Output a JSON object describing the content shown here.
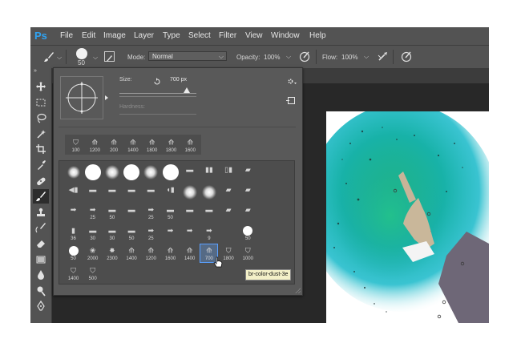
{
  "app": {
    "logo": "Ps",
    "menu": [
      "File",
      "Edit",
      "Image",
      "Layer",
      "Type",
      "Select",
      "Filter",
      "View",
      "Window",
      "Help"
    ]
  },
  "options_bar": {
    "brush_size": "50",
    "mode_label": "Mode:",
    "mode_value": "Normal",
    "opacity_label": "Opacity:",
    "opacity_value": "100%",
    "flow_label": "Flow:",
    "flow_value": "100%"
  },
  "toolbar": {
    "icons": [
      "move-icon",
      "marquee-icon",
      "lasso-icon",
      "quick-select-icon",
      "crop-icon",
      "eyedropper-icon",
      "healing-icon",
      "brush-icon",
      "stamp-icon",
      "history-brush-icon",
      "eraser-icon",
      "gradient-icon",
      "blur-icon",
      "dodge-icon",
      "pen-icon"
    ],
    "active_index": 7
  },
  "brush_panel": {
    "size_label": "Size:",
    "size_value": "700 px",
    "size_slider_fraction": 0.88,
    "hardness_label": "Hardness:",
    "top_row": [
      "100",
      "1200",
      "200",
      "1400",
      "1800",
      "1800",
      "1600"
    ],
    "grid": [
      [
        {
          "t": "soft",
          "s": 16,
          "n": ""
        },
        {
          "t": "hard",
          "s": 20,
          "n": ""
        },
        {
          "t": "soft",
          "s": 18,
          "n": ""
        },
        {
          "t": "hard",
          "s": 20,
          "n": ""
        },
        {
          "t": "soft",
          "s": 18,
          "n": ""
        },
        {
          "t": "hard",
          "s": 20,
          "n": ""
        },
        {
          "t": "glyph",
          "g": "▬",
          "n": ""
        },
        {
          "t": "glyph",
          "g": "▮▮",
          "n": ""
        },
        {
          "t": "glyph",
          "g": "▯▮",
          "n": ""
        },
        {
          "t": "glyph",
          "g": "▰",
          "n": ""
        }
      ],
      [
        {
          "t": "glyph",
          "g": "◀▮",
          "n": ""
        },
        {
          "t": "glyph",
          "g": "▬",
          "n": ""
        },
        {
          "t": "glyph",
          "g": "▬",
          "n": ""
        },
        {
          "t": "glyph",
          "g": "▬",
          "n": ""
        },
        {
          "t": "glyph",
          "g": "▬",
          "n": ""
        },
        {
          "t": "glyph",
          "g": "◖▮",
          "n": ""
        },
        {
          "t": "soft",
          "s": 18,
          "n": ""
        },
        {
          "t": "soft",
          "s": 18,
          "n": ""
        },
        {
          "t": "glyph",
          "g": "▰",
          "n": ""
        },
        {
          "t": "glyph",
          "g": "▰",
          "n": ""
        }
      ],
      [
        {
          "t": "glyph",
          "g": "➡",
          "n": ""
        },
        {
          "t": "glyph",
          "g": "➡",
          "n": "25"
        },
        {
          "t": "glyph",
          "g": "▬",
          "n": "50"
        },
        {
          "t": "glyph",
          "g": "▬",
          "n": ""
        },
        {
          "t": "glyph",
          "g": "➡",
          "n": "25"
        },
        {
          "t": "glyph",
          "g": "▬",
          "n": "50"
        },
        {
          "t": "glyph",
          "g": "▬",
          "n": ""
        },
        {
          "t": "glyph",
          "g": "▬",
          "n": ""
        },
        {
          "t": "glyph",
          "g": "▰",
          "n": ""
        },
        {
          "t": "glyph",
          "g": "▰",
          "n": ""
        }
      ],
      [
        {
          "t": "glyph",
          "g": "▮",
          "n": "36"
        },
        {
          "t": "glyph",
          "g": "▬",
          "n": "30"
        },
        {
          "t": "glyph",
          "g": "▬",
          "n": "30"
        },
        {
          "t": "glyph",
          "g": "▬",
          "n": "50"
        },
        {
          "t": "glyph",
          "g": "➡",
          "n": "25"
        },
        {
          "t": "glyph",
          "g": "➡",
          "n": ""
        },
        {
          "t": "glyph",
          "g": "➡",
          "n": ""
        },
        {
          "t": "glyph",
          "g": "➡",
          "n": "9"
        },
        {
          "t": "glyph",
          "g": "",
          "n": ""
        },
        {
          "t": "hard",
          "s": 12,
          "n": "50"
        }
      ],
      [
        {
          "t": "hard",
          "s": 12,
          "n": "50"
        },
        {
          "t": "glyph",
          "g": "❀",
          "n": "2000"
        },
        {
          "t": "glyph",
          "g": "✸",
          "n": "2300"
        },
        {
          "t": "glyph",
          "g": "⟰",
          "n": "1400"
        },
        {
          "t": "glyph",
          "g": "⟰",
          "n": "1200"
        },
        {
          "t": "glyph",
          "g": "⟰",
          "n": "1600"
        },
        {
          "t": "glyph",
          "g": "⟰",
          "n": "1400"
        },
        {
          "t": "glyph",
          "g": "⟰",
          "n": "700",
          "sel": true
        },
        {
          "t": "glyph",
          "g": "⛉",
          "n": "1800"
        },
        {
          "t": "glyph",
          "g": "⛉",
          "n": "1000"
        }
      ],
      [
        {
          "t": "glyph",
          "g": "⛉",
          "n": "1400"
        },
        {
          "t": "glyph",
          "g": "⛉",
          "n": "500"
        }
      ]
    ],
    "tooltip": "br-color-dust-3e"
  },
  "colors": {
    "accent": "#2fa3f2",
    "selection": "#5aa0ff",
    "background_green": "#1fb47f",
    "background_teal": "#16c2c8"
  }
}
